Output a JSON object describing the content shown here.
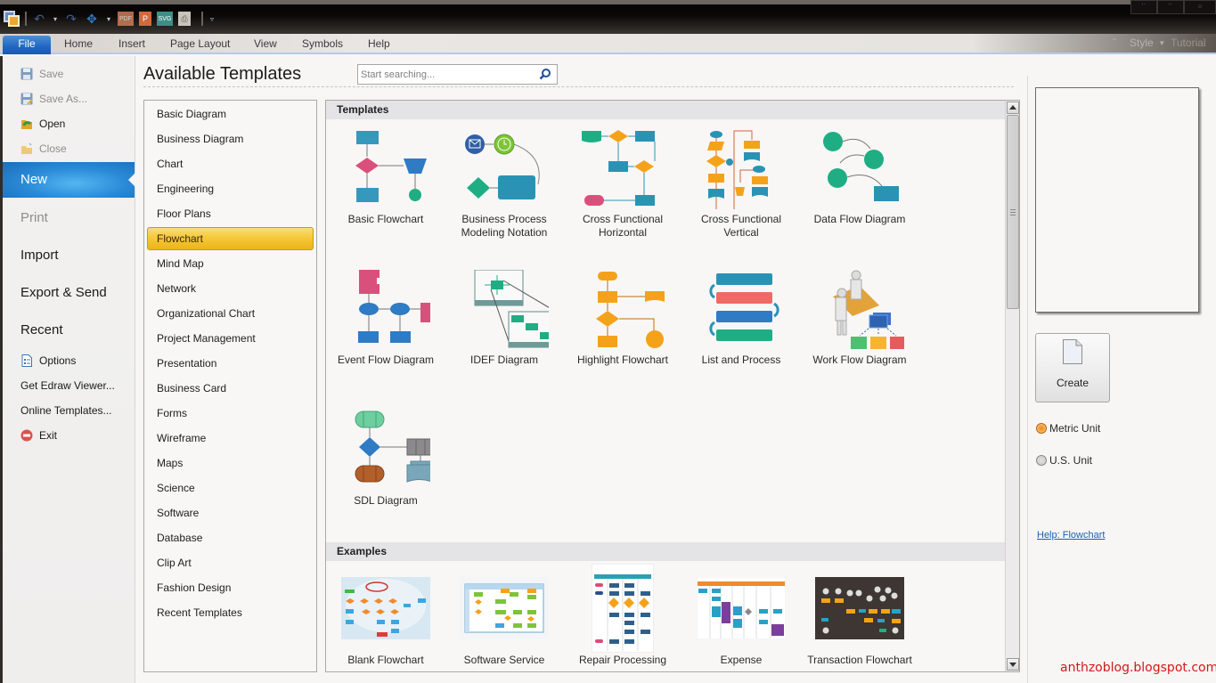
{
  "window": {
    "quick_access": [
      "app-logo",
      "undo-icon",
      "redo-icon",
      "move-icon",
      "PDF",
      "P",
      "SVG",
      "print-preview-icon"
    ],
    "qat_pdf": "PDF",
    "qat_ppt": "P",
    "qat_svg": "SVG",
    "controls": {
      "minimize": "▪",
      "maximize": "▪",
      "close": "✕"
    }
  },
  "ribbon": {
    "tabs": [
      "File",
      "Home",
      "Insert",
      "Page Layout",
      "View",
      "Symbols",
      "Help"
    ],
    "right": {
      "style_label": "Style",
      "tutorial_label": "Tutorial"
    }
  },
  "backstage": {
    "items": [
      {
        "label": "Save",
        "icon": "save-icon",
        "disabled": true
      },
      {
        "label": "Save As...",
        "icon": "save-as-icon",
        "disabled": true
      },
      {
        "label": "Open",
        "icon": "open-icon",
        "disabled": false
      },
      {
        "label": "Close",
        "icon": "close-folder-icon",
        "disabled": true
      },
      {
        "label": "New",
        "selected": true
      },
      {
        "label": "Print",
        "disabled": true
      },
      {
        "label": "Import"
      },
      {
        "label": "Export & Send"
      },
      {
        "label": "Recent"
      },
      {
        "label": "Options",
        "icon": "options-icon"
      },
      {
        "label": "Get Edraw Viewer..."
      },
      {
        "label": "Online Templates..."
      },
      {
        "label": "Exit",
        "icon": "exit-icon"
      }
    ]
  },
  "main": {
    "title": "Available Templates",
    "search": {
      "placeholder": "Start searching...",
      "value": ""
    },
    "categories": [
      "Basic Diagram",
      "Business Diagram",
      "Chart",
      "Engineering",
      "Floor Plans",
      "Flowchart",
      "Mind Map",
      "Network",
      "Organizational Chart",
      "Project Management",
      "Presentation",
      "Business Card",
      "Forms",
      "Wireframe",
      "Maps",
      "Science",
      "Software",
      "Database",
      "Clip Art",
      "Fashion Design",
      "Recent Templates"
    ],
    "selected_category": "Flowchart",
    "templates_header": "Templates",
    "templates": [
      {
        "line1": "Basic Flowchart",
        "line2": ""
      },
      {
        "line1": "Business Process",
        "line2": "Modeling Notation"
      },
      {
        "line1": "Cross Functional",
        "line2": "Horizontal"
      },
      {
        "line1": "Cross Functional",
        "line2": "Vertical"
      },
      {
        "line1": "Data Flow Diagram",
        "line2": ""
      },
      {
        "line1": "Event Flow Diagram",
        "line2": ""
      },
      {
        "line1": "IDEF Diagram",
        "line2": ""
      },
      {
        "line1": "Highlight Flowchart",
        "line2": ""
      },
      {
        "line1": "List and Process",
        "line2": ""
      },
      {
        "line1": "Work Flow Diagram",
        "line2": ""
      },
      {
        "line1": "SDL Diagram",
        "line2": ""
      }
    ],
    "examples_header": "Examples",
    "examples": [
      {
        "label": "Blank Flowchart"
      },
      {
        "label": "Software Service"
      },
      {
        "label": "Repair Processing"
      },
      {
        "label": "Expense"
      },
      {
        "label": "Transaction Flowchart"
      }
    ]
  },
  "right_panel": {
    "create_label": "Create",
    "units": [
      {
        "label": "Metric Unit",
        "checked": true
      },
      {
        "label": "U.S. Unit",
        "checked": false
      }
    ],
    "help_link": "Help: Flowchart"
  },
  "watermark": "anthzoblog.blogspot.com",
  "colors": {
    "accent_blue": "#2a8ad6",
    "selected_yellow": "#f6c83a",
    "teal": "#2a93b5",
    "green": "#1fae84",
    "orange": "#f5a21b",
    "pink": "#d9507c",
    "watermark_red": "#d31818"
  }
}
